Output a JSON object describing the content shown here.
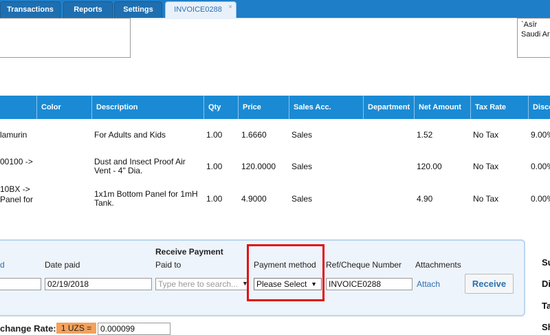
{
  "tabs": [
    {
      "label": "Transactions"
    },
    {
      "label": "Reports"
    },
    {
      "label": "Settings"
    },
    {
      "label": "INVOICE0288",
      "close": "×"
    }
  ],
  "address": {
    "line1": "`Asīr",
    "line2": "Saudi Ar"
  },
  "table": {
    "headers": [
      "Color",
      "Description",
      "Qty",
      "Price",
      "Sales Acc.",
      "Department",
      "Net Amount",
      "Tax Rate",
      "Disco"
    ],
    "rows": [
      {
        "item": "lamurin",
        "description": "For Adults and Kids",
        "qty": "1.00",
        "price": "1.6660",
        "sales_acc": "Sales",
        "net": "1.52",
        "tax": "No Tax",
        "disc": "9.00%"
      },
      {
        "item": "00100 ->",
        "description": "Dust and Insect Proof Air Vent - 4\" Dia.",
        "qty": "1.00",
        "price": "120.0000",
        "sales_acc": "Sales",
        "net": "120.00",
        "tax": "No Tax",
        "disc": "0.00%"
      },
      {
        "item": "10BX ->",
        "item2": "Panel for",
        "description": "1x1m Bottom Panel for 1mH Tank.",
        "qty": "1.00",
        "price": "4.9000",
        "sales_acc": "Sales",
        "net": "4.90",
        "tax": "No Tax",
        "disc": "0.00%"
      }
    ]
  },
  "payment": {
    "heading": "Receive Payment",
    "cut_label": "d",
    "date_label": "Date paid",
    "date_value": "02/19/2018",
    "paid_to_label": "Paid to",
    "paid_to_placeholder": "Type here to search...",
    "method_label": "Payment method",
    "method_value": "Please Select",
    "ref_label": "Ref/Cheque Number",
    "ref_value": "INVOICE0288",
    "attachments_label": "Attachments",
    "attach_link": "Attach",
    "receive_button": "Receive"
  },
  "exchange": {
    "label": "change Rate:",
    "chip": "1 UZS =",
    "value": "0.000099"
  },
  "side_labels": [
    "Su",
    "Di",
    "Ta",
    "Sh"
  ],
  "colors": {
    "tabbar": "#1e7ec8",
    "table_header": "#1a8ad4",
    "highlight": "#e01010",
    "link": "#2a6fb0"
  }
}
